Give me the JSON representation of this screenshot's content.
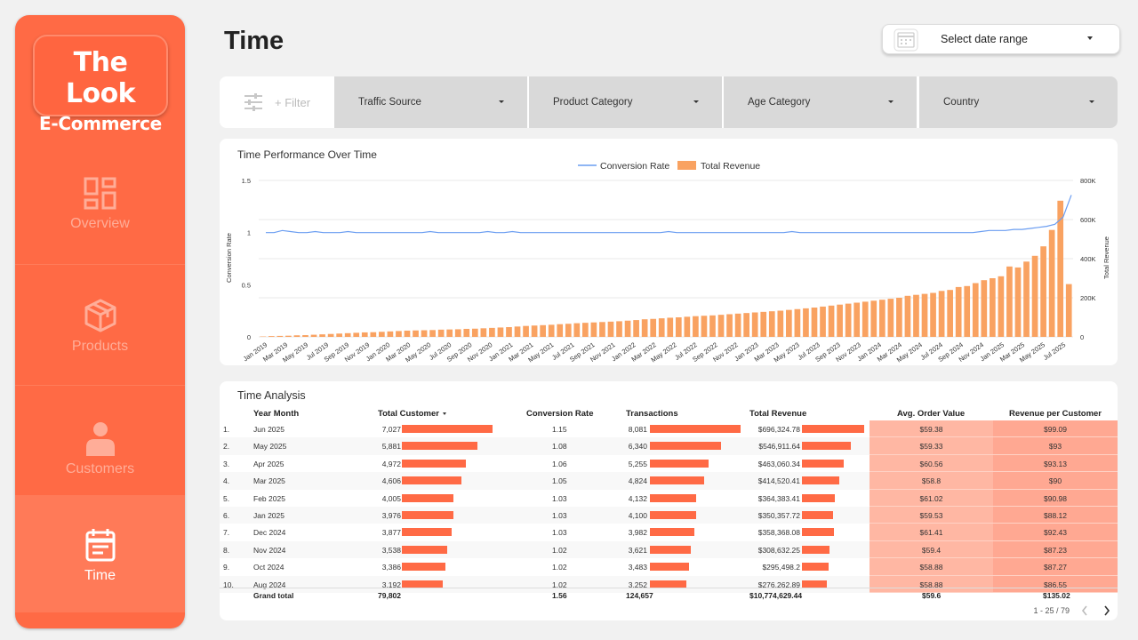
{
  "app": {
    "logo_line1": "The Look",
    "logo_line2": "E-Commerce",
    "accent_color": "#ff6a45"
  },
  "sidebar": {
    "items": [
      {
        "label": "Overview",
        "icon": "dashboard-icon",
        "active": false
      },
      {
        "label": "Products",
        "icon": "package-icon",
        "active": false
      },
      {
        "label": "Customers",
        "icon": "user-icon",
        "active": false
      },
      {
        "label": "Time",
        "icon": "calendar-icon",
        "active": true
      }
    ]
  },
  "header": {
    "title": "Time",
    "date_range_placeholder": "Select date range"
  },
  "filters": {
    "filter_label": "+ Filter",
    "dropdowns": [
      "Traffic Source",
      "Product Category",
      "Age Category",
      "Country"
    ]
  },
  "chart_data": {
    "type": "bar",
    "title": "Time Performance Over Time",
    "ylabel": "Conversion Rate",
    "y2label": "Total Revenue",
    "legend": [
      "Conversion Rate",
      "Total Revenue"
    ],
    "legend_position": "top-center",
    "ylim": [
      0,
      1.5
    ],
    "y2lim": [
      0,
      800000
    ],
    "yticks": [
      "0",
      "0.5",
      "1",
      "1.5"
    ],
    "y2ticks": [
      "0",
      "200K",
      "400K",
      "600K",
      "800K"
    ],
    "xtick_labels": [
      "Jan 2019",
      "Mar 2019",
      "May 2019",
      "Jul 2019",
      "Sep 2019",
      "Nov 2019",
      "Jan 2020",
      "Mar 2020",
      "May 2020",
      "Jul 2020",
      "Sep 2020",
      "Nov 2020",
      "Jan 2021",
      "Mar 2021",
      "May 2021",
      "Jul 2021",
      "Sep 2021",
      "Nov 2021",
      "Jan 2022",
      "Mar 2022",
      "May 2022",
      "Jul 2022",
      "Sep 2022",
      "Nov 2022",
      "Jan 2023",
      "Mar 2023",
      "May 2023",
      "Jul 2023",
      "Sep 2023",
      "Nov 2023",
      "Jan 2024",
      "Mar 2024",
      "May 2024",
      "Jul 2024",
      "Sep 2024",
      "Nov 2024",
      "Jan 2025",
      "Mar 2025",
      "May 2025",
      "Jul 2025"
    ],
    "series": [
      {
        "name": "Total Revenue",
        "color": "#f9a261",
        "values": [
          2000,
          4000,
          5000,
          6000,
          8000,
          9000,
          11000,
          13000,
          15000,
          17000,
          19000,
          21000,
          23000,
          24000,
          26000,
          28000,
          30000,
          32000,
          33000,
          34000,
          35000,
          37000,
          38000,
          39000,
          41000,
          42000,
          44000,
          46000,
          48000,
          50000,
          53000,
          56000,
          58000,
          60000,
          62000,
          65000,
          67000,
          70000,
          72000,
          74000,
          76000,
          78000,
          80000,
          83000,
          86000,
          90000,
          92000,
          95000,
          98000,
          100000,
          103000,
          106000,
          108000,
          110000,
          113000,
          116000,
          119000,
          122000,
          125000,
          128000,
          131000,
          134000,
          138000,
          142000,
          146000,
          150000,
          155000,
          160000,
          165000,
          170000,
          175000,
          180000,
          185000,
          190000,
          195000,
          200000,
          210000,
          215000,
          220000,
          225000,
          235000,
          240000,
          255000,
          260000,
          275000,
          290000,
          300000,
          310000,
          360000,
          355000,
          385000,
          414520,
          463060,
          546912,
          696325,
          270000
        ]
      },
      {
        "name": "Conversion Rate",
        "color": "#6a9df1",
        "values": [
          1.0,
          1.0,
          1.02,
          1.01,
          1.0,
          1.0,
          1.01,
          1.0,
          1.0,
          1.0,
          1.01,
          1.0,
          1.0,
          1.0,
          1.0,
          1.0,
          1.0,
          1.0,
          1.0,
          1.0,
          1.01,
          1.0,
          1.0,
          1.0,
          1.0,
          1.0,
          1.0,
          1.01,
          1.0,
          1.0,
          1.01,
          1.0,
          1.0,
          1.0,
          1.0,
          1.0,
          1.0,
          1.0,
          1.0,
          1.0,
          1.0,
          1.0,
          1.0,
          1.0,
          1.0,
          1.0,
          1.0,
          1.0,
          1.0,
          1.01,
          1.0,
          1.0,
          1.0,
          1.0,
          1.0,
          1.0,
          1.0,
          1.0,
          1.0,
          1.0,
          1.0,
          1.0,
          1.0,
          1.0,
          1.01,
          1.0,
          1.0,
          1.0,
          1.0,
          1.0,
          1.0,
          1.0,
          1.0,
          1.0,
          1.0,
          1.0,
          1.0,
          1.0,
          1.0,
          1.0,
          1.0,
          1.0,
          1.0,
          1.0,
          1.0,
          1.0,
          1.0,
          1.01,
          1.02,
          1.02,
          1.02,
          1.03,
          1.03,
          1.04,
          1.05,
          1.06,
          1.08,
          1.15,
          1.36
        ]
      }
    ]
  },
  "table": {
    "title": "Time Analysis",
    "columns": [
      "Year Month",
      "Total Customer",
      "Conversion Rate",
      "Transactions",
      "Total Revenue",
      "Avg. Order Value",
      "Revenue per Customer"
    ],
    "rows": [
      {
        "idx": "1.",
        "ym": "Jun 2025",
        "cust": "7,027",
        "cust_val": 7027,
        "conv": "1.15",
        "trans": "8,081",
        "trans_val": 8081,
        "rev": "$696,324.78",
        "rev_val": 696324.78,
        "aov": "$59.38",
        "rpc": "$99.09"
      },
      {
        "idx": "2.",
        "ym": "May 2025",
        "cust": "5,881",
        "cust_val": 5881,
        "conv": "1.08",
        "trans": "6,340",
        "trans_val": 6340,
        "rev": "$546,911.64",
        "rev_val": 546911.64,
        "aov": "$59.33",
        "rpc": "$93"
      },
      {
        "idx": "3.",
        "ym": "Apr 2025",
        "cust": "4,972",
        "cust_val": 4972,
        "conv": "1.06",
        "trans": "5,255",
        "trans_val": 5255,
        "rev": "$463,060.34",
        "rev_val": 463060.34,
        "aov": "$60.56",
        "rpc": "$93.13"
      },
      {
        "idx": "4.",
        "ym": "Mar 2025",
        "cust": "4,606",
        "cust_val": 4606,
        "conv": "1.05",
        "trans": "4,824",
        "trans_val": 4824,
        "rev": "$414,520.41",
        "rev_val": 414520.41,
        "aov": "$58.8",
        "rpc": "$90"
      },
      {
        "idx": "5.",
        "ym": "Feb 2025",
        "cust": "4,005",
        "cust_val": 4005,
        "conv": "1.03",
        "trans": "4,132",
        "trans_val": 4132,
        "rev": "$364,383.41",
        "rev_val": 364383.41,
        "aov": "$61.02",
        "rpc": "$90.98"
      },
      {
        "idx": "6.",
        "ym": "Jan 2025",
        "cust": "3,976",
        "cust_val": 3976,
        "conv": "1.03",
        "trans": "4,100",
        "trans_val": 4100,
        "rev": "$350,357.72",
        "rev_val": 350357.72,
        "aov": "$59.53",
        "rpc": "$88.12"
      },
      {
        "idx": "7.",
        "ym": "Dec 2024",
        "cust": "3,877",
        "cust_val": 3877,
        "conv": "1.03",
        "trans": "3,982",
        "trans_val": 3982,
        "rev": "$358,368.08",
        "rev_val": 358368.08,
        "aov": "$61.41",
        "rpc": "$92.43"
      },
      {
        "idx": "8.",
        "ym": "Nov 2024",
        "cust": "3,538",
        "cust_val": 3538,
        "conv": "1.02",
        "trans": "3,621",
        "trans_val": 3621,
        "rev": "$308,632.25",
        "rev_val": 308632.25,
        "aov": "$59.4",
        "rpc": "$87.23"
      },
      {
        "idx": "9.",
        "ym": "Oct 2024",
        "cust": "3,386",
        "cust_val": 3386,
        "conv": "1.02",
        "trans": "3,483",
        "trans_val": 3483,
        "rev": "$295,498.2",
        "rev_val": 295498.2,
        "aov": "$58.88",
        "rpc": "$87.27"
      },
      {
        "idx": "10.",
        "ym": "Aug 2024",
        "cust": "3,192",
        "cust_val": 3192,
        "conv": "1.02",
        "trans": "3,252",
        "trans_val": 3252,
        "rev": "$276,262.89",
        "rev_val": 276262.89,
        "aov": "$58.88",
        "rpc": "$86.55"
      }
    ],
    "total": {
      "label": "Grand total",
      "cust": "79,802",
      "conv": "1.56",
      "trans": "124,657",
      "rev": "$10,774,629.44",
      "aov": "$59.6",
      "rpc": "$135.02"
    },
    "pagination": "1 - 25 / 79"
  }
}
